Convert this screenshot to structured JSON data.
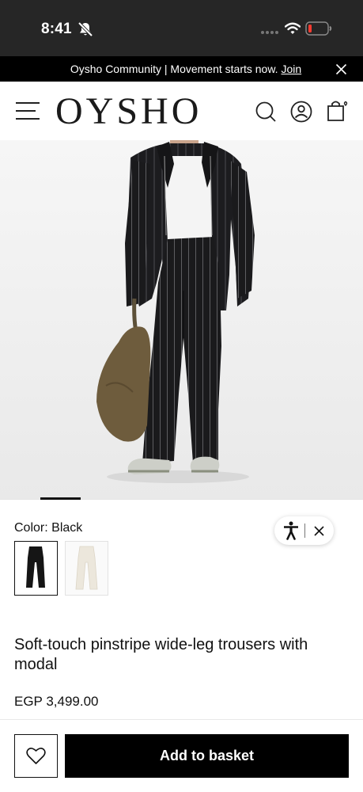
{
  "status_bar": {
    "time": "8:41",
    "icons": [
      "bell-off-icon",
      "signal-icon",
      "wifi-icon",
      "battery-icon"
    ],
    "battery_color": "#ff3b30"
  },
  "promo_banner": {
    "text": "Oysho Community | Movement starts now.",
    "link_label": "Join",
    "close_icon": "close-icon"
  },
  "header": {
    "brand": "OYSHO",
    "icons": [
      "menu-icon",
      "search-icon",
      "account-icon",
      "bag-icon"
    ]
  },
  "product": {
    "image_icon": "product-photo",
    "color_label": "Color:",
    "color_value": "Black",
    "swatches": [
      {
        "name": "Black",
        "selected": true,
        "color": "#151515"
      },
      {
        "name": "White",
        "selected": false,
        "color": "#efebe2"
      }
    ],
    "title": "Soft-touch pinstripe wide-leg trousers with modal",
    "price": "EGP 3,499.00"
  },
  "accessibility_widget": {
    "icons": [
      "accessibility-icon",
      "close-icon"
    ]
  },
  "actions": {
    "wishlist_icon": "heart-icon",
    "add_to_basket_label": "Add to basket"
  },
  "colors": {
    "status_bar_bg": "#262626",
    "banner_bg": "#000000",
    "button_bg": "#000000",
    "text": "#111111"
  }
}
